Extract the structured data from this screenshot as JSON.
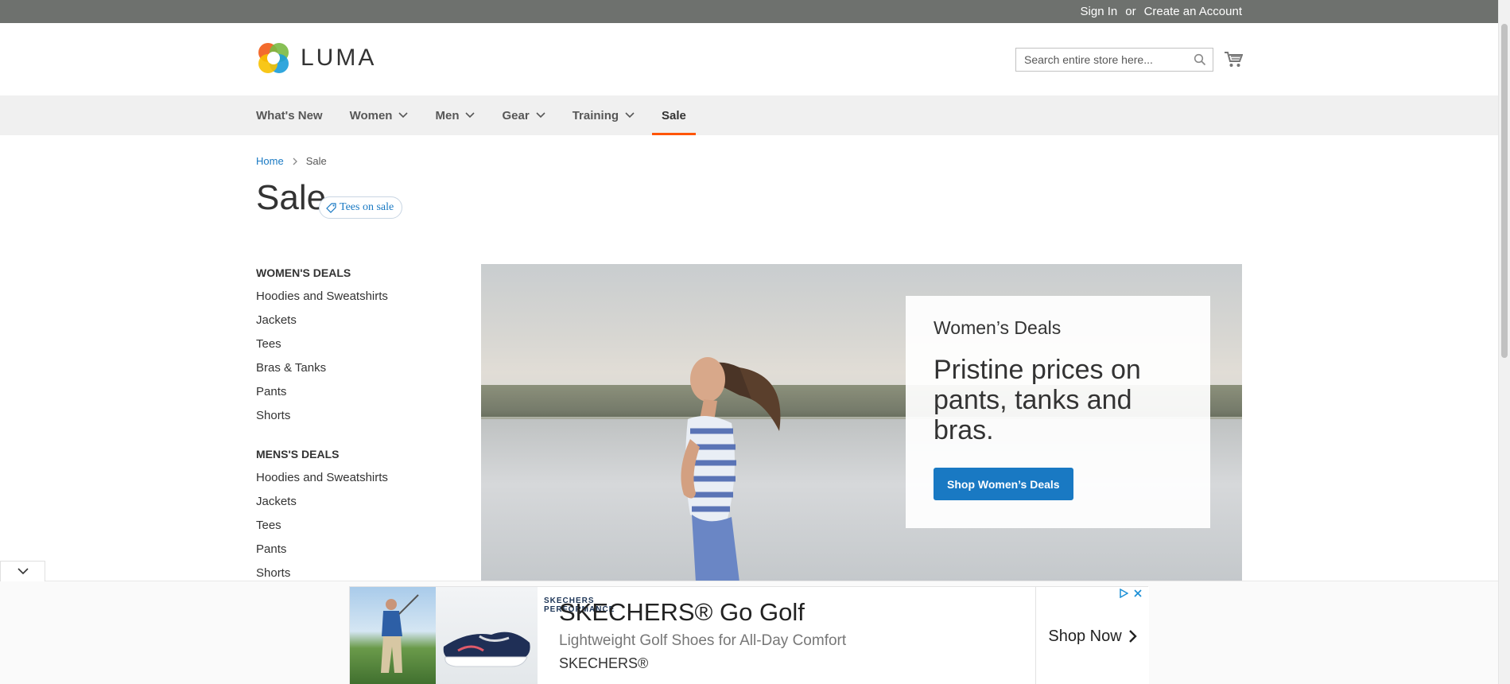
{
  "topbar": {
    "sign_in": "Sign In",
    "or": "or",
    "create_account": "Create an Account"
  },
  "header": {
    "logo_text": "LUMA",
    "search_placeholder": "Search entire store here..."
  },
  "nav": {
    "items": [
      {
        "label": "What's New",
        "has_dropdown": false
      },
      {
        "label": "Women",
        "has_dropdown": true
      },
      {
        "label": "Men",
        "has_dropdown": true
      },
      {
        "label": "Gear",
        "has_dropdown": true
      },
      {
        "label": "Training",
        "has_dropdown": true
      },
      {
        "label": "Sale",
        "has_dropdown": false,
        "active": true
      }
    ]
  },
  "breadcrumb": {
    "home": "Home",
    "current": "Sale"
  },
  "page": {
    "title": "Sale",
    "tag": "Tees on sale"
  },
  "sidebar": {
    "groups": [
      {
        "heading": "WOMEN'S DEALS",
        "items": [
          "Hoodies and Sweatshirts",
          "Jackets",
          "Tees",
          "Bras & Tanks",
          "Pants",
          "Shorts"
        ]
      },
      {
        "heading": "MENS'S DEALS",
        "items": [
          "Hoodies and Sweatshirts",
          "Jackets",
          "Tees",
          "Pants",
          "Shorts"
        ]
      }
    ]
  },
  "hero": {
    "subtitle": "Women’s Deals",
    "title": "Pristine prices on pants, tanks and bras.",
    "button": "Shop Women’s Deals"
  },
  "ad": {
    "brand_logo": "SKECHERS PERFORMANCE",
    "title": "SKECHERS® Go Golf",
    "description": "Lightweight Golf Shoes for All-Day Comfort",
    "advertiser": "SKECHERS®",
    "cta": "Shop Now"
  },
  "colors": {
    "accent_orange": "#ff5501",
    "link_blue": "#1979c3",
    "topbar": "#6e716e",
    "nav_bg": "#f0f0f0"
  },
  "icons": [
    "search-icon",
    "cart-icon",
    "chevron-down-icon",
    "tag-icon",
    "chevron-right-icon",
    "adchoices-icon",
    "close-icon"
  ]
}
